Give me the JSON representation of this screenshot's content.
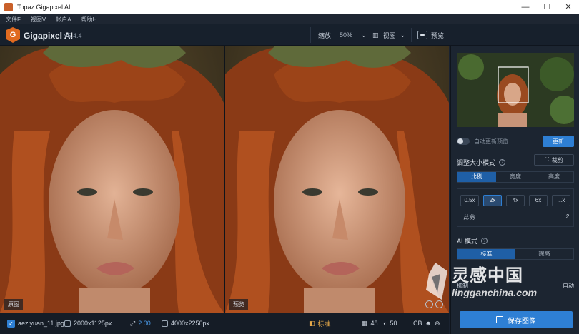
{
  "window": {
    "title": "Topaz Gigapixel AI",
    "controls": [
      "—",
      "☐",
      "✕"
    ]
  },
  "menu": [
    "文件F",
    "视图V",
    "帐户A",
    "帮助H"
  ],
  "header": {
    "logo_letter": "G",
    "brand": "Gigapixel AI",
    "version": "v5.4.4",
    "zoom_label": "缩放",
    "zoom_value": "50%",
    "view_label": "视图",
    "preview_label": "预览"
  },
  "panes": {
    "left_label": "原图",
    "right_label": "预览"
  },
  "status": {
    "filename": "aeziyuan_11.jpg",
    "orig_size": "2000x1125px",
    "scale": "2.00",
    "out_size": "4000x2250px",
    "mode": "标准",
    "noise": "48",
    "blur": "50",
    "cb": "CB"
  },
  "sidebar": {
    "auto_preview": "自动更新预览",
    "update": "更新",
    "resize_title": "调整大小模式",
    "crop": "裁剪",
    "resize_tabs": [
      "比例",
      "宽度",
      "高度"
    ],
    "scale_options": [
      "0.5x",
      "2x",
      "4x",
      "6x",
      "...x"
    ],
    "ratio_label": "比例",
    "ratio_value": "2",
    "ai_title": "AI 模式",
    "ai_tabs": [
      "标准",
      "提高"
    ],
    "noise_label": "抑制",
    "noise_auto": "自动",
    "save": "保存图像"
  },
  "watermark": {
    "name": "灵感中国",
    "url": "lingganchina.com"
  },
  "colors": {
    "accent": "#2e7fd4",
    "brand": "#e06a20"
  }
}
